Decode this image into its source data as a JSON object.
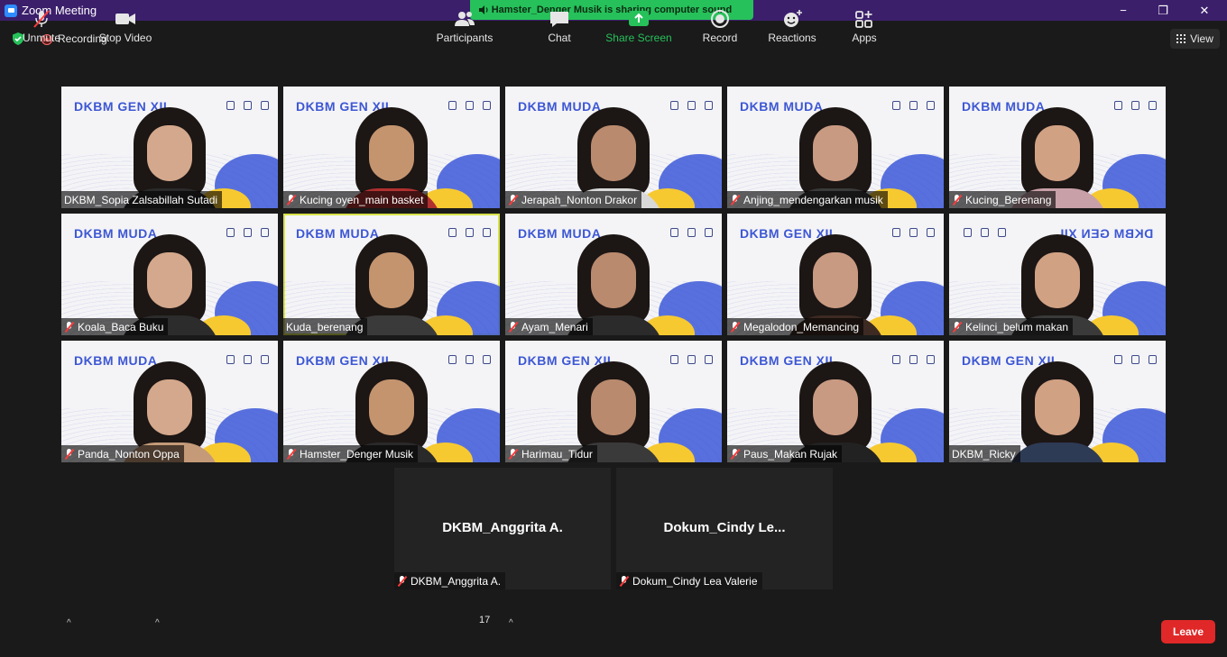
{
  "window": {
    "title": "Zoom Meeting",
    "minimize": "−",
    "maximize": "❐",
    "close": "✕"
  },
  "share_banner": "Hamster_Denger Musik is sharing computer sound",
  "top": {
    "recording": "Recording",
    "view": "View"
  },
  "participants": [
    {
      "name": "DKBM_Sopia Zalsabillah Sutadi",
      "brand": "DKBM GEN XII",
      "muted": false
    },
    {
      "name": "Kucing oyen_main basket",
      "brand": "DKBM GEN XII",
      "muted": true
    },
    {
      "name": "Jerapah_Nonton Drakor",
      "brand": "DKBM MUDA",
      "muted": true
    },
    {
      "name": "Anjing_mendengarkan musik",
      "brand": "DKBM MUDA",
      "muted": true
    },
    {
      "name": "Kucing_Berenang",
      "brand": "DKBM MUDA",
      "muted": true
    },
    {
      "name": "Koala_Baca Buku",
      "brand": "DKBM MUDA",
      "muted": true
    },
    {
      "name": "Kuda_berenang",
      "brand": "DKBM MUDA",
      "muted": false
    },
    {
      "name": "Ayam_Menari",
      "brand": "DKBM MUDA",
      "muted": true
    },
    {
      "name": "Megalodon_Memancing",
      "brand": "DKBM GEN XII",
      "muted": true
    },
    {
      "name": "Kelinci_belum makan",
      "brand": "DKBM GEN XII",
      "muted": true
    },
    {
      "name": "Panda_Nonton Oppa",
      "brand": "DKBM MUDA",
      "muted": true
    },
    {
      "name": "Hamster_Denger Musik",
      "brand": "DKBM GEN XII",
      "muted": true
    },
    {
      "name": "Harimau_Tidur",
      "brand": "DKBM GEN XII",
      "muted": true
    },
    {
      "name": "Paus_Makan Rujak",
      "brand": "DKBM GEN XII",
      "muted": true
    },
    {
      "name": "DKBM_Ricky",
      "brand": "DKBM GEN XII",
      "muted": false
    }
  ],
  "no_video": [
    {
      "display": "DKBM_Anggrita A.",
      "name": "DKBM_Anggrita A.",
      "muted": true
    },
    {
      "display": "Dokum_Cindy  Le...",
      "name": "Dokum_Cindy Lea Valerie",
      "muted": true
    }
  ],
  "toolbar": {
    "unmute": "Unmute",
    "stop_video": "Stop Video",
    "participants": "Participants",
    "participants_count": "17",
    "chat": "Chat",
    "share_screen": "Share Screen",
    "record": "Record",
    "reactions": "Reactions",
    "apps": "Apps",
    "leave": "Leave"
  },
  "colors": {
    "titlebar": "#3b1f6b",
    "share_green": "#26c15a",
    "leave_red": "#e02828",
    "brand_blue": "#3d57d4",
    "active_speaker": "#d8e24a"
  }
}
